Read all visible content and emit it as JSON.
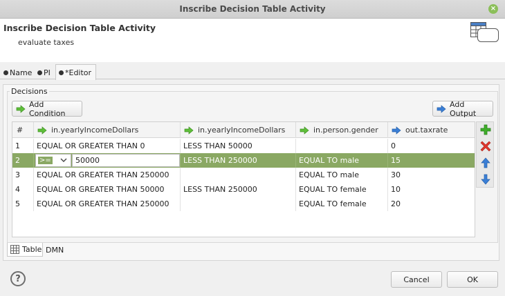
{
  "window": {
    "title": "Inscribe Decision Table Activity"
  },
  "header": {
    "title": "Inscribe Decision Table Activity",
    "description": "evaluate taxes"
  },
  "tabs": [
    {
      "label": "Name"
    },
    {
      "label": "PI"
    },
    {
      "label": "*Editor",
      "active": true
    }
  ],
  "group": {
    "label": "Decisions"
  },
  "buttons": {
    "add_condition": "Add Condition",
    "add_output": "Add Output",
    "cancel": "Cancel",
    "ok": "OK"
  },
  "table": {
    "columns": [
      {
        "label": "#",
        "kind": "index"
      },
      {
        "label": "in.yearlyIncomeDollars",
        "kind": "condition"
      },
      {
        "label": "in.yearlyIncomeDollars",
        "kind": "condition"
      },
      {
        "label": "in.person.gender",
        "kind": "condition"
      },
      {
        "label": "out.taxrate",
        "kind": "output"
      }
    ],
    "rows": [
      [
        "1",
        "EQUAL OR GREATER THAN 0",
        "LESS THAN 50000",
        "",
        "0"
      ],
      [
        "2",
        "",
        "LESS THAN 250000",
        "EQUAL TO male",
        "15"
      ],
      [
        "3",
        "EQUAL OR GREATER THAN 250000",
        "",
        "EQUAL TO male",
        "30"
      ],
      [
        "4",
        "EQUAL OR GREATER THAN 50000",
        "LESS THAN 250000",
        "EQUAL TO female",
        "10"
      ],
      [
        "5",
        "EQUAL OR GREATER THAN 250000",
        "",
        "EQUAL TO female",
        "20"
      ]
    ],
    "selected_row": 2,
    "editor": {
      "operator": ">=",
      "value": "50000"
    }
  },
  "bottom_tabs": [
    {
      "label": "Table",
      "active": true
    },
    {
      "label": "DMN"
    }
  ],
  "colors": {
    "selection": "#8aa863",
    "condition_arrow": "#5fbf3a",
    "output_arrow": "#3b7fd6"
  },
  "icons": [
    "close-icon",
    "table-icon",
    "add-row-icon",
    "remove-row-icon",
    "move-up-icon",
    "move-down-icon",
    "help-icon"
  ]
}
